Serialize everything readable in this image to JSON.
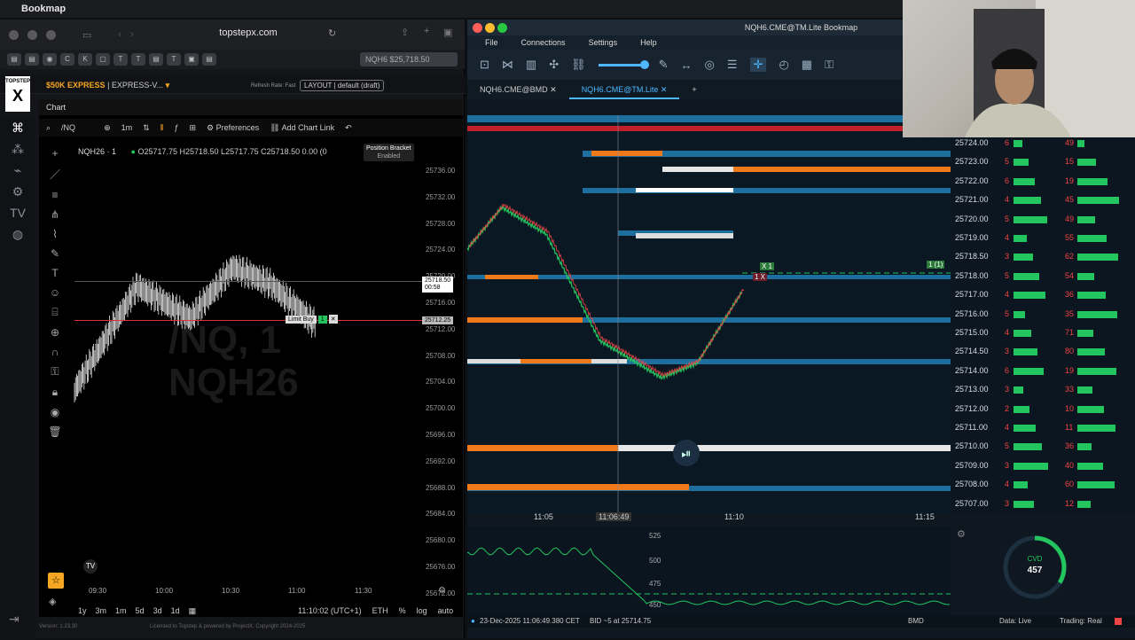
{
  "menubar": {
    "app_name": "Bookmap"
  },
  "browser": {
    "url": "topstepx.com",
    "price_tab": "NQH6 $25,718.50"
  },
  "topstep": {
    "logo_top": "TOPSTEP",
    "logo_letter": "X",
    "account": "$50K EXPRESS",
    "account_suffix": "| EXPRESS-V...",
    "refresh_label": "Refresh Rate: Fast",
    "layout": "LAYOUT | default (draft)"
  },
  "chart": {
    "header_title": "Chart",
    "search": "/NQ",
    "timeframe": "1m",
    "preferences": "Preferences",
    "add_chart_link": "Add Chart Link",
    "symbol": "NQH26 · 1",
    "ohlc": "O25717.75 H25718.50 L25717.75 C25718.50 0.00 (0",
    "position_bracket": "Position Bracket",
    "position_bracket_state": "Enabled",
    "watermark_line1": "/NQ, 1",
    "watermark_line2": "NQH26",
    "limit_buy_label": "Limit Buy",
    "limit_buy_qty": "1",
    "current_price": "25718.50",
    "current_countdown": "00:58",
    "limit_price": "25712.25",
    "y_ticks": [
      "25736.00",
      "25732.00",
      "25728.00",
      "25724.00",
      "25720.00",
      "25716.00",
      "25712.00",
      "25708.00",
      "25704.00",
      "25700.00",
      "25696.00",
      "25692.00",
      "25688.00",
      "25684.00",
      "25680.00",
      "25676.00",
      "25672.00"
    ],
    "x_ticks": [
      "09:30",
      "10:00",
      "10:30",
      "11:00",
      "11:30"
    ],
    "ranges": [
      "1y",
      "3m",
      "1m",
      "5d",
      "3d",
      "1d"
    ],
    "clock": "11:10:02 (UTC+1)",
    "session": "ETH",
    "pct": "%",
    "log": "log",
    "auto": "auto",
    "footer_version": "Version: 1.23.30",
    "footer_license": "Licensed to Topstep & powered by ProjectX. Copyright 2024-2025"
  },
  "bookmap": {
    "window_title": "NQH6.CME@TM.Lite   Bookmap",
    "menu": [
      "File",
      "Connections",
      "Settings",
      "Help"
    ],
    "tabs": [
      "NQH6.CME@BMD",
      "NQH6.CME@TM.Lite"
    ],
    "active_tab": 1,
    "price_ticks": [
      "25724.00",
      "25723.00",
      "25722.00",
      "25721.00",
      "25720.00",
      "25719.00",
      "25718.50",
      "25718.00",
      "25717.00",
      "25716.00",
      "25715.00",
      "25714.50",
      "25714.00",
      "25713.00",
      "25712.00",
      "25711.00",
      "25710.00",
      "25709.00",
      "25708.00",
      "25707.00"
    ],
    "time_ticks": [
      "11:05",
      "11:06:49",
      "11:10",
      "11:15"
    ],
    "cvd_ticks": [
      "525",
      "500",
      "475",
      "450"
    ],
    "cvd_label": "CVD",
    "cvd_value": "457",
    "position_label": "1 (1)",
    "trade_labels": [
      "X 1",
      "1 X"
    ],
    "status_datetime": "23-Dec-2025 11:06:49.380 CET",
    "status_bid": "BID ~5 at 25714.75",
    "status_feed": "BMD",
    "status_data": "Data: Live",
    "status_trading": "Trading: Real",
    "dom_bids": [
      "6",
      "5",
      "6",
      "4",
      "5",
      "4",
      "3",
      "5",
      "4",
      "5",
      "4",
      "3",
      "6",
      "3",
      "2",
      "4",
      "5",
      "3",
      "4",
      "3"
    ],
    "dom_asks": [
      "49",
      "15",
      "19",
      "45",
      "49",
      "55",
      "62",
      "54",
      "36",
      "35",
      "71",
      "80",
      "19",
      "33",
      "10",
      "11",
      "36",
      "40",
      "60",
      "12"
    ]
  },
  "colors": {
    "accent": "#4db7ff",
    "bid": "#22c55e",
    "ask": "#ef4444",
    "heat_blue": "#1f6f9e",
    "heat_orange": "#f07a1a"
  }
}
